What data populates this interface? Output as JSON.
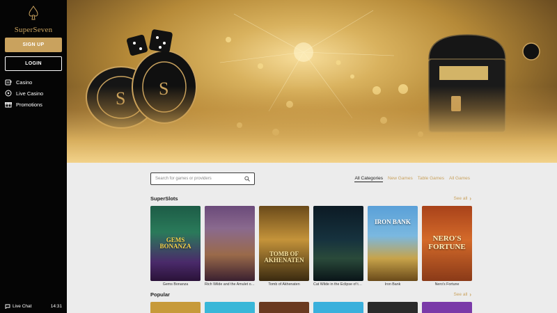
{
  "brand": {
    "name": "SuperSeven",
    "accent": "#c9a25e"
  },
  "auth": {
    "signup_label": "SIGN UP",
    "login_label": "LOGIN"
  },
  "nav": [
    {
      "label": "Casino",
      "icon": "slot-machine-icon"
    },
    {
      "label": "Live Casino",
      "icon": "play-circle-icon"
    },
    {
      "label": "Promotions",
      "icon": "gift-icon"
    }
  ],
  "footer": {
    "chat_label": "Live Chat",
    "time": "14:31"
  },
  "search": {
    "placeholder": "Search for games or providers"
  },
  "tabs": [
    "All Categories",
    "New Games",
    "Table Games",
    "All Games"
  ],
  "sections": {
    "superslots": {
      "title": "SuperSlots",
      "see_all": "See all"
    },
    "popular": {
      "title": "Popular",
      "see_all": "See all"
    }
  },
  "games": [
    {
      "title": "Gems Bonanza",
      "art": "GEMS BONANZA"
    },
    {
      "title": "Rich Wilde and the Amulet of ...",
      "art": ""
    },
    {
      "title": "Tomb of Akhenaten",
      "art": "TOMB OF AKHENATEN"
    },
    {
      "title": "Cat Wilde in the Eclipse of th...",
      "art": ""
    },
    {
      "title": "Iron Bank",
      "art": "IRON BANK"
    },
    {
      "title": "Nero's Fortune",
      "art": "NERO'S FORTUNE"
    }
  ]
}
